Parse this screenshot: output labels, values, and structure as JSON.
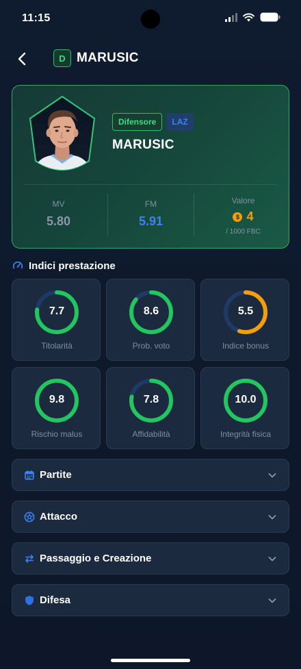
{
  "status_bar": {
    "time": "11:15"
  },
  "header": {
    "position_letter": "D",
    "title": "MARUSIC"
  },
  "player": {
    "role": "Difensore",
    "team": "LAZ",
    "name": "MARUSIC",
    "stats": [
      {
        "label": "MV",
        "value": "5.80"
      },
      {
        "label": "FM",
        "value": "5.91"
      },
      {
        "label": "Valore",
        "value": "4",
        "sub": "/ 1000 FBC"
      }
    ]
  },
  "performance": {
    "title": "Indici prestazione",
    "metrics": [
      {
        "label": "Titolarità",
        "value": "7.7",
        "level": 0.77,
        "color": "#22c55e"
      },
      {
        "label": "Prob. voto",
        "value": "8.6",
        "level": 0.86,
        "color": "#22c55e"
      },
      {
        "label": "Indice bonus",
        "value": "5.5",
        "level": 0.55,
        "color": "#f59e0b"
      },
      {
        "label": "Rischio malus",
        "value": "9.8",
        "level": 0.98,
        "color": "#22c55e"
      },
      {
        "label": "Affidabilità",
        "value": "7.8",
        "level": 0.78,
        "color": "#22c55e"
      },
      {
        "label": "Integrità fisica",
        "value": "10.0",
        "level": 1.0,
        "color": "#22c55e"
      }
    ]
  },
  "sections": [
    {
      "label": "Partite",
      "icon": "calendar-icon"
    },
    {
      "label": "Attacco",
      "icon": "soccer-ball-icon"
    },
    {
      "label": "Passaggio e Creazione",
      "icon": "swap-arrows-icon"
    },
    {
      "label": "Difesa",
      "icon": "shield-icon"
    }
  ],
  "colors": {
    "accent_green": "#22c55e",
    "accent_blue": "#3b82f6",
    "accent_orange": "#f59e0b",
    "background": "#0f1a2e"
  }
}
